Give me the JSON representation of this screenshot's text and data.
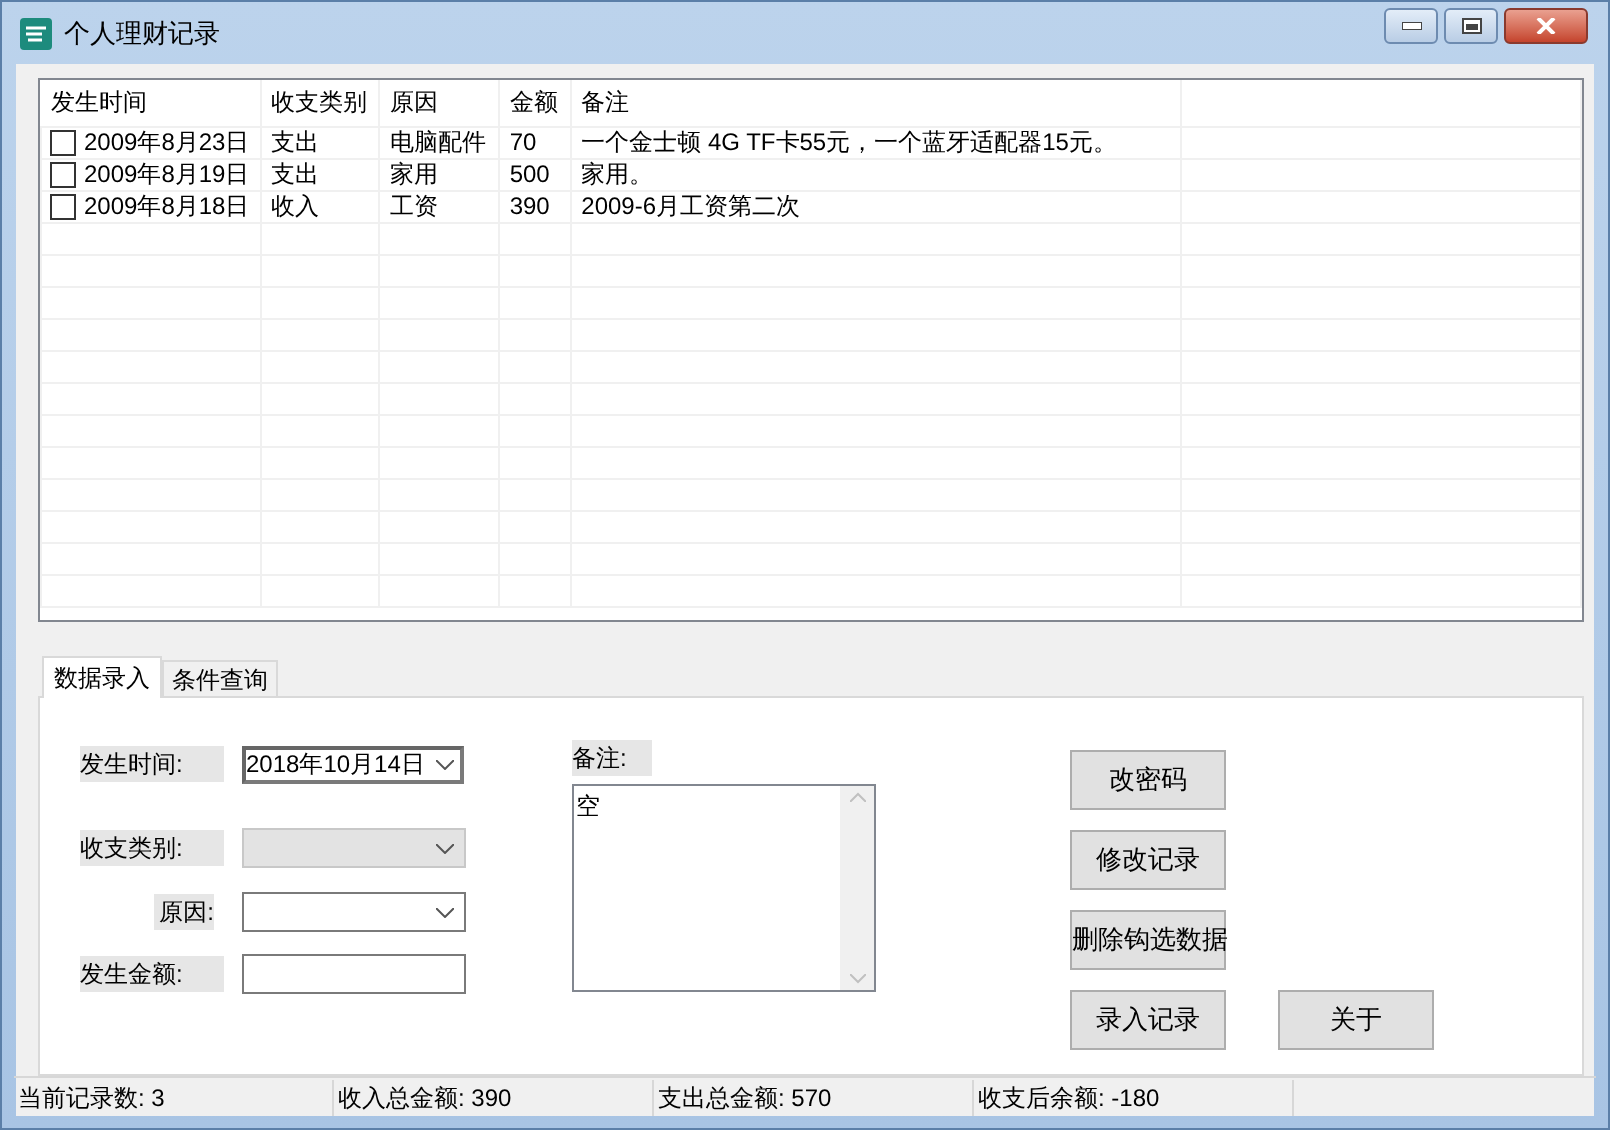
{
  "window": {
    "title": "个人理财记录"
  },
  "table": {
    "columns": [
      "发生时间",
      "收支类别",
      "原因",
      "金额",
      "备注"
    ],
    "rows": [
      {
        "checked": false,
        "cells": [
          "2009年8月23日",
          "支出",
          "电脑配件",
          "70",
          "一个金士顿 4G TF卡55元，一个蓝牙适配器15元。"
        ]
      },
      {
        "checked": false,
        "cells": [
          "2009年8月19日",
          "支出",
          "家用",
          "500",
          "家用。"
        ]
      },
      {
        "checked": false,
        "cells": [
          "2009年8月18日",
          "收入",
          "工资",
          "390",
          "2009-6月工资第二次"
        ]
      }
    ]
  },
  "tabs": [
    {
      "label": "数据录入",
      "selected": true
    },
    {
      "label": "条件查询",
      "selected": false
    }
  ],
  "form": {
    "fields": [
      {
        "kind": "date",
        "label": "发生时间:",
        "value": "2018年10月14日",
        "disabled": false
      },
      {
        "kind": "combo",
        "label": "收支类别:",
        "disabled": true
      },
      {
        "kind": "combo",
        "label": "原因:",
        "disabled": false
      },
      {
        "kind": "text",
        "label": "发生金额:",
        "disabled": false
      }
    ],
    "memo": {
      "label": "备注:",
      "value": "空"
    },
    "buttons": [
      "改密码",
      "修改记录",
      "删除钩选数据",
      "录入记录"
    ],
    "about_button": "关于"
  },
  "status_bar": [
    "当前记录数: 3",
    "收入总金额: 390",
    "支出总金额: 570",
    "收支后余额: -180"
  ]
}
